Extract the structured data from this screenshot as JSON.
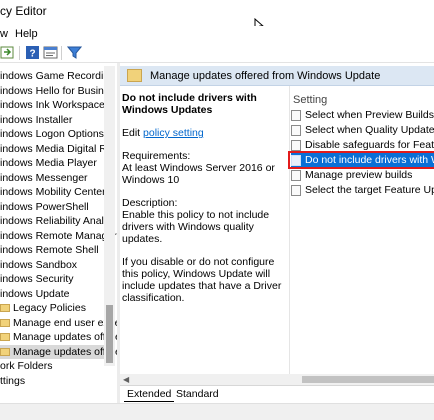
{
  "window": {
    "title": "cy Editor"
  },
  "menu": {
    "view_label": "w",
    "help_label": "Help"
  },
  "tree": {
    "items": [
      {
        "label": "indows Game Recording",
        "indent": 0
      },
      {
        "label": "indows Hello for Busine",
        "indent": 0
      },
      {
        "label": "indows Ink Workspace",
        "indent": 0
      },
      {
        "label": "indows Installer",
        "indent": 0
      },
      {
        "label": "indows Logon Options",
        "indent": 0
      },
      {
        "label": "indows Media Digital Rig",
        "indent": 0
      },
      {
        "label": "indows Media Player",
        "indent": 0
      },
      {
        "label": "indows Messenger",
        "indent": 0
      },
      {
        "label": "indows Mobility Center",
        "indent": 0
      },
      {
        "label": "indows PowerShell",
        "indent": 0
      },
      {
        "label": "indows Reliability Analys",
        "indent": 0
      },
      {
        "label": "indows Remote Manager",
        "indent": 0
      },
      {
        "label": "indows Remote Shell",
        "indent": 0
      },
      {
        "label": "indows Sandbox",
        "indent": 0
      },
      {
        "label": "indows Security",
        "indent": 0
      },
      {
        "label": "indows Update",
        "indent": 0
      },
      {
        "label": "Legacy Policies",
        "indent": 1
      },
      {
        "label": "Manage end user exper",
        "indent": 1
      },
      {
        "label": "Manage updates offere",
        "indent": 1
      },
      {
        "label": "Manage updates offere",
        "indent": 1,
        "selected": true
      },
      {
        "label": "ork Folders",
        "indent": 0
      },
      {
        "label": "ttings",
        "indent": 0
      }
    ]
  },
  "header": {
    "title": "Manage updates offered from Windows Update"
  },
  "description": {
    "heading": "Do not include drivers with Windows Updates",
    "edit_prefix": "Edit ",
    "edit_link": "policy setting",
    "requirements_label": "Requirements:",
    "requirements_text": "At least Windows Server 2016 or Windows 10",
    "description_label": "Description:",
    "description_text": "Enable this policy to not include drivers with Windows quality updates.",
    "disable_text": "If you disable or do not configure this policy, Windows Update will include updates that have a Driver classification."
  },
  "settings": {
    "column_header": "Setting",
    "items": [
      {
        "label": "Select when Preview Builds and"
      },
      {
        "label": "Select when Quality Updates ar"
      },
      {
        "label": "Disable safeguards for Feature"
      },
      {
        "label": "Do not include drivers with Win",
        "highlight": true
      },
      {
        "label": "Manage preview builds"
      },
      {
        "label": "Select the target Feature Updat"
      }
    ]
  },
  "tabs": {
    "extended": "Extended",
    "standard": "Standard"
  },
  "colors": {
    "selection": "#0a6fd6",
    "annotation_box": "#e21b1b",
    "header_bar": "#dce7f3"
  }
}
